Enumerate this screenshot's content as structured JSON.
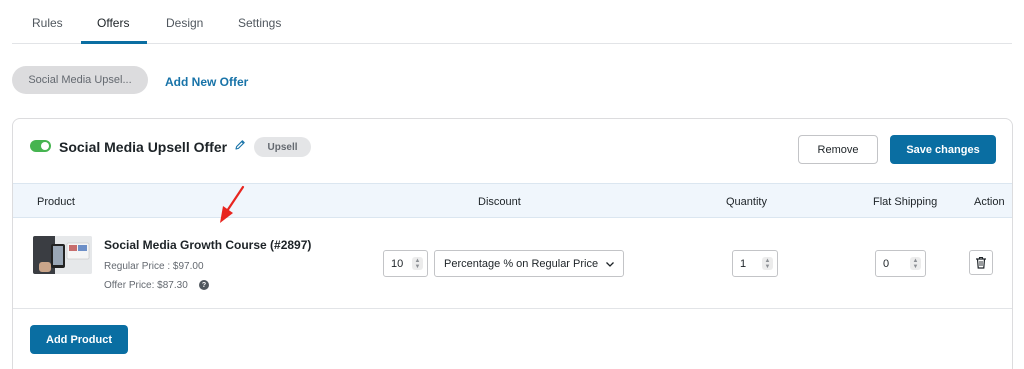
{
  "tabs": [
    {
      "label": "Rules"
    },
    {
      "label": "Offers"
    },
    {
      "label": "Design"
    },
    {
      "label": "Settings"
    }
  ],
  "active_tab": "Offers",
  "offers_bar": {
    "offer_pill": "Social Media Upsel...",
    "add_new_offer": "Add New Offer"
  },
  "offer": {
    "enabled": true,
    "title": "Social Media Upsell Offer",
    "badge": "Upsell",
    "remove_label": "Remove",
    "save_label": "Save changes"
  },
  "table": {
    "headers": {
      "product": "Product",
      "discount": "Discount",
      "quantity": "Quantity",
      "flat_shipping": "Flat Shipping",
      "action": "Action"
    },
    "rows": [
      {
        "product_name": "Social Media Growth Course (#2897)",
        "regular_price": "Regular Price : $97.00",
        "offer_price": "Offer Price: $87.30",
        "discount_value": "10",
        "discount_type": "Percentage % on Regular Price",
        "quantity": "1",
        "flat_shipping": "0"
      }
    ]
  },
  "add_product_label": "Add Product",
  "colors": {
    "primary": "#0a6ea2",
    "link": "#1873a8",
    "toggle_on": "#46b450",
    "table_header_bg": "#f0f6fc",
    "annotation_arrow": "#e8251f"
  },
  "icons": [
    "edit-pencil-icon",
    "help-icon",
    "spinner-icon",
    "chevron-down-icon",
    "trash-icon",
    "annotation-arrow-icon"
  ]
}
